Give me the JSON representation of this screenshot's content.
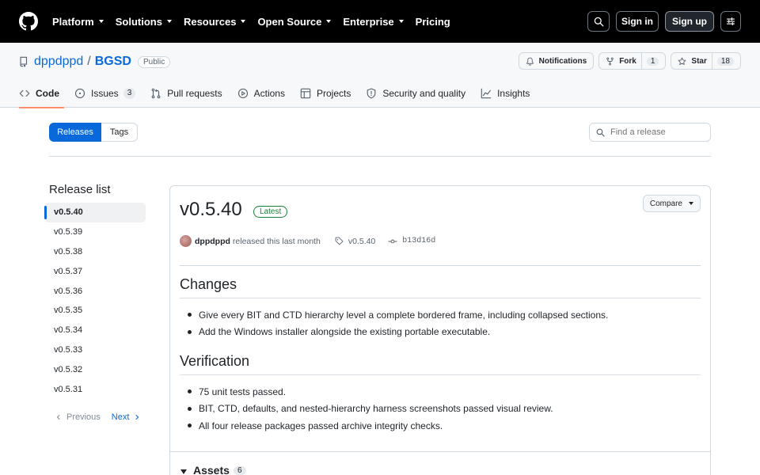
{
  "topnav": {
    "items": [
      "Platform",
      "Solutions",
      "Resources",
      "Open Source",
      "Enterprise",
      "Pricing"
    ],
    "has_caret": [
      true,
      true,
      true,
      true,
      true,
      false
    ],
    "signin": "Sign in",
    "signup": "Sign up"
  },
  "repo": {
    "owner": "dppdppd",
    "name": "BGSD",
    "visibility": "Public",
    "notifications": "Notifications",
    "fork": "Fork",
    "fork_count": "1",
    "star": "Star",
    "star_count": "18"
  },
  "tabs": [
    {
      "label": "Code",
      "count": "",
      "icon": "code-icon"
    },
    {
      "label": "Issues",
      "count": "3",
      "icon": "issue-icon"
    },
    {
      "label": "Pull requests",
      "count": "",
      "icon": "pull-request-icon"
    },
    {
      "label": "Actions",
      "count": "",
      "icon": "play-icon"
    },
    {
      "label": "Projects",
      "count": "",
      "icon": "table-icon"
    },
    {
      "label": "Security and quality",
      "count": "",
      "icon": "shield-icon"
    },
    {
      "label": "Insights",
      "count": "",
      "icon": "graph-icon"
    }
  ],
  "releases_bar": {
    "releases": "Releases",
    "tags": "Tags",
    "find_placeholder": "Find a release"
  },
  "sidebar": {
    "title": "Release list",
    "items": [
      "v0.5.40",
      "v0.5.39",
      "v0.5.38",
      "v0.5.37",
      "v0.5.36",
      "v0.5.35",
      "v0.5.34",
      "v0.5.33",
      "v0.5.32",
      "v0.5.31"
    ],
    "previous": "Previous",
    "next": "Next"
  },
  "release": {
    "version": "v0.5.40",
    "badge": "Latest",
    "compare": "Compare",
    "author": "dppdppd",
    "released_text": "released this last month",
    "tag": "v0.5.40",
    "commit": "b13d16d",
    "sections": [
      {
        "heading": "Changes",
        "items": [
          "Give every BIT and CTD hierarchy level a complete bordered frame, including collapsed sections.",
          "Add the Windows installer alongside the existing portable executable."
        ]
      },
      {
        "heading": "Verification",
        "items": [
          "75 unit tests passed.",
          "BIT, CTD, defaults, and nested-hierarchy harness screenshots passed visual review.",
          "All four release packages passed archive integrity checks."
        ]
      }
    ],
    "assets_label": "Assets",
    "assets_count": "6"
  }
}
